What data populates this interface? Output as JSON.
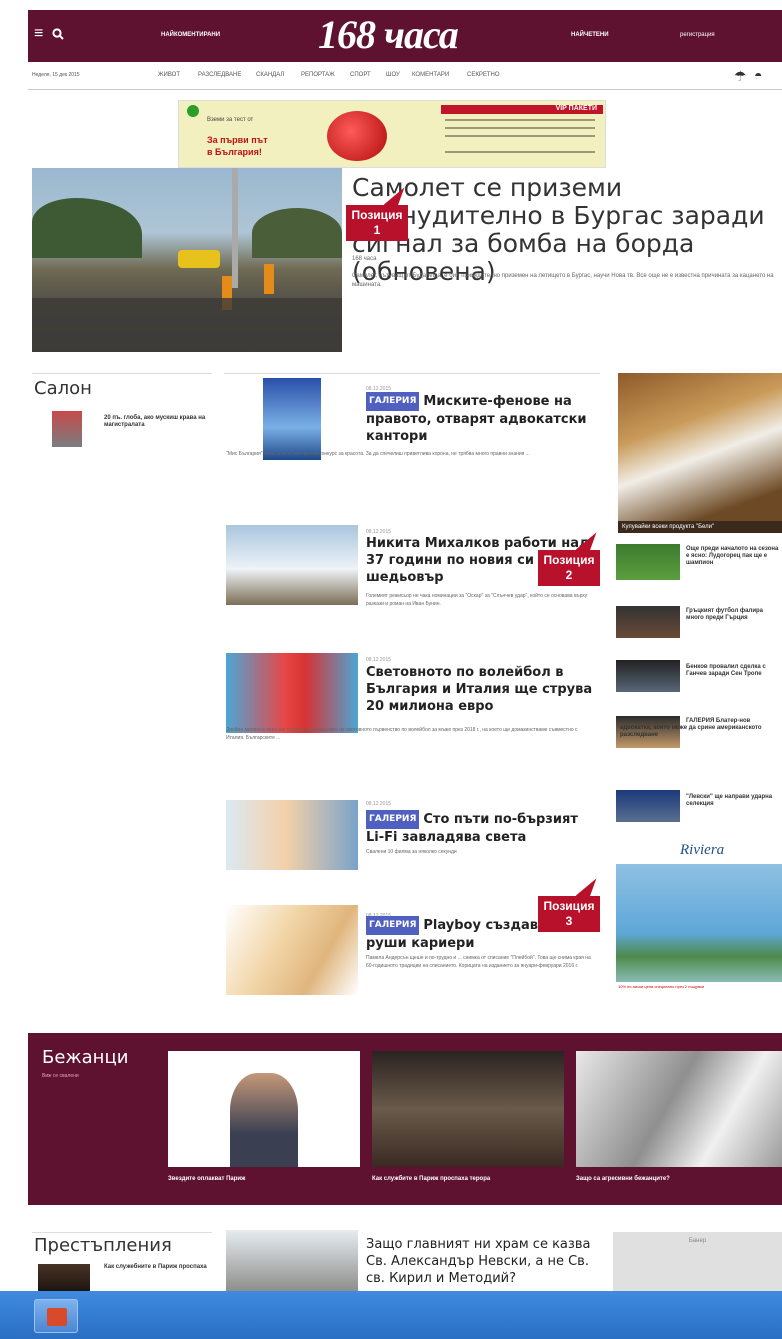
{
  "header": {
    "logo": "168 часа",
    "left_link": "НАЙКОМЕНТИРАНИ",
    "right_link": "НАЙЧЕТЕНИ",
    "register": "регистрация",
    "date": "Неделя, 15 дек 2015"
  },
  "nav": {
    "items": [
      "ЖИВОТ",
      "РАЗСЛЕДВАНЕ",
      "СКАНДАЛ",
      "РЕПОРТАЖ",
      "СПОРТ",
      "ШОУ",
      "КОМЕНТАРИ",
      "СЕКРЕТНО"
    ]
  },
  "banner": {
    "left_line1": "Вземи за тест от",
    "left_line2": "За първи път",
    "left_line3": "в България!",
    "right_title": "VIP ПАКЕТИ"
  },
  "hero": {
    "title": "Самолет се приземи принудително в Бургас заради сигнал за бомба на борда (обновена)",
    "source": "168 часа",
    "lead": "Самолет, пътуващ от Будапеща, е бил принудително приземен на летището в Бургас, научи Нова тв. Все още не е известна причината за кацането на машината."
  },
  "badges": {
    "p1": "Позиция\n1",
    "p2": "Позиция\n2",
    "p3": "Позиция\n3"
  },
  "salon": {
    "title": "Салон",
    "item": "20 пъ. глоба, ако мускиш крава на магистралата"
  },
  "articles": [
    {
      "gallery": "ГАЛЕРИЯ",
      "title": "Миските-фенове на правото, отварят адвокатски кантори",
      "lead": "\"Мис България\" няма и не е бил просто конкурс за красота. За да спечелиш приветлива корона, не трябва много правни знания ...",
      "meta": "08.12.2015"
    },
    {
      "gallery": "",
      "title": "Никита Михалков работи над 37 години по новия си шедьовър",
      "lead": "Големият режисьор не чака номинации за \"Оскар\" за \"Слънчев удар\", който се основава върху разкази и роман на Иван Бунин.",
      "meta": "08.12.2015"
    },
    {
      "gallery": "",
      "title": "Световното по волейбол в България и Италия ще струва 20 милиона евро",
      "lead": "Двойно милиона евро ще струва организацията на световното първенство по волейбол за мъже през 2018 г., на което ще домакинстваме съвместно с Италия. Българските ...",
      "meta": "08.12.2015"
    },
    {
      "gallery": "ГАЛЕРИЯ",
      "title": "Сто пъти по-бързият Li-Fi завладява света",
      "lead": "Свалени 10 филма за няколко секунди",
      "meta": "08.12.2015"
    },
    {
      "gallery": "ГАЛЕРИЯ",
      "title": "Playboy създава или руши кариери",
      "lead": "Памела Андерсън щеше и по-трудно и ... снимка от списание \"Плейбой\". Това ще снима края на 60-годишното традиции на списанието. Корицата на изданието за януари-февруари 2016 г.",
      "meta": "08.12.2015"
    }
  ],
  "side": {
    "ad_caption": "Купувайки всеки продукта \"Бели\"",
    "items": [
      "Още преди началото на сезона е ясно: Лудогорец пак ще е шампион",
      "Гръцкият футбол фалира много преди Гърция",
      "Бенков провалил сделка с Ганчев заради Сен Тропе",
      "ГАЛЕРИЯ Блатер-нов адвокатка, която може да срине американското разследване",
      "\"Левски\" ще направи ударна селекция"
    ],
    "riviera_logo": "Riviera",
    "riviera_caption": "10% по-ниски цени специално през 2 нощувки"
  },
  "refugees": {
    "title": "Бежанци",
    "subtitle": "Виж се свалени",
    "captions": [
      "Звездите оплакват Париж",
      "Как службите в Париж проспаха терора",
      "Защо са агресивни бежанците?"
    ]
  },
  "crime": {
    "title": "Престъпления",
    "item": "Как служебните в Париж проспаха",
    "article_title": "Защо главният ни храм се казва Св. Александър Невски, а не Св. св. Кирил и Методий?",
    "side_label": "Банер"
  }
}
